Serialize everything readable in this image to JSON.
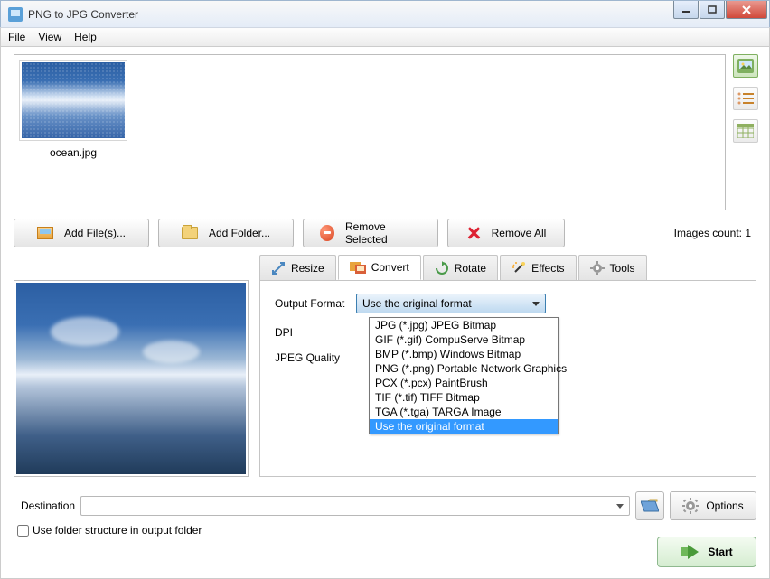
{
  "window": {
    "title": "PNG to JPG Converter"
  },
  "menu": {
    "file": "File",
    "view": "View",
    "help": "Help"
  },
  "file": {
    "name": "ocean.jpg"
  },
  "toolbar": {
    "add_files": "Add File(s)...",
    "add_folder": "Add Folder...",
    "remove_selected": "Remove Selected",
    "remove_all_prefix": "Remove ",
    "remove_all_underlined": "A",
    "remove_all_suffix": "ll",
    "count_label": "Images count: 1"
  },
  "tabs": {
    "resize": "Resize",
    "convert": "Convert",
    "rotate": "Rotate",
    "effects": "Effects",
    "tools": "Tools"
  },
  "convert": {
    "output_format_label": "Output Format",
    "dpi_label": "DPI",
    "jpeg_quality_label": "JPEG Quality",
    "selected": "Use the original format",
    "options": [
      "JPG (*.jpg) JPEG Bitmap",
      "GIF (*.gif) CompuServe Bitmap",
      "BMP (*.bmp) Windows Bitmap",
      "PNG (*.png) Portable Network Graphics",
      "PCX (*.pcx) PaintBrush",
      "TIF (*.tif) TIFF Bitmap",
      "TGA (*.tga) TARGA Image",
      "Use the original format"
    ]
  },
  "bottom": {
    "destination_label": "Destination",
    "options_label": "Options",
    "use_folder_structure": "Use folder structure in output folder",
    "start_label": "Start"
  }
}
